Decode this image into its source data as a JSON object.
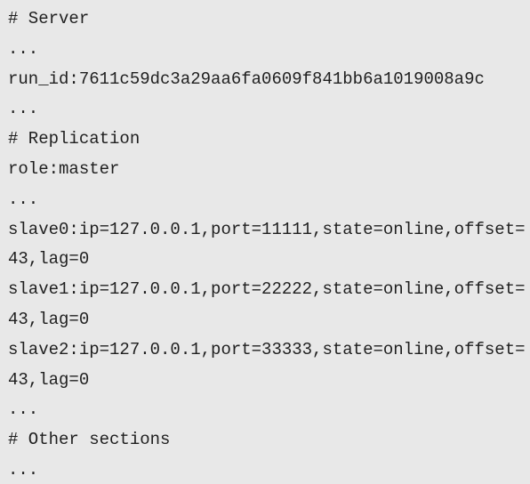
{
  "output": {
    "lines": [
      "# Server",
      "...",
      "run_id:7611c59dc3a29aa6fa0609f841bb6a1019008a9c",
      "...",
      "# Replication",
      "role:master",
      "...",
      "slave0:ip=127.0.0.1,port=11111,state=online,offset=",
      "43,lag=0",
      "slave1:ip=127.0.0.1,port=22222,state=online,offset=",
      "43,lag=0",
      "slave2:ip=127.0.0.1,port=33333,state=online,offset=",
      "43,lag=0",
      "...",
      "# Other sections",
      "..."
    ]
  }
}
